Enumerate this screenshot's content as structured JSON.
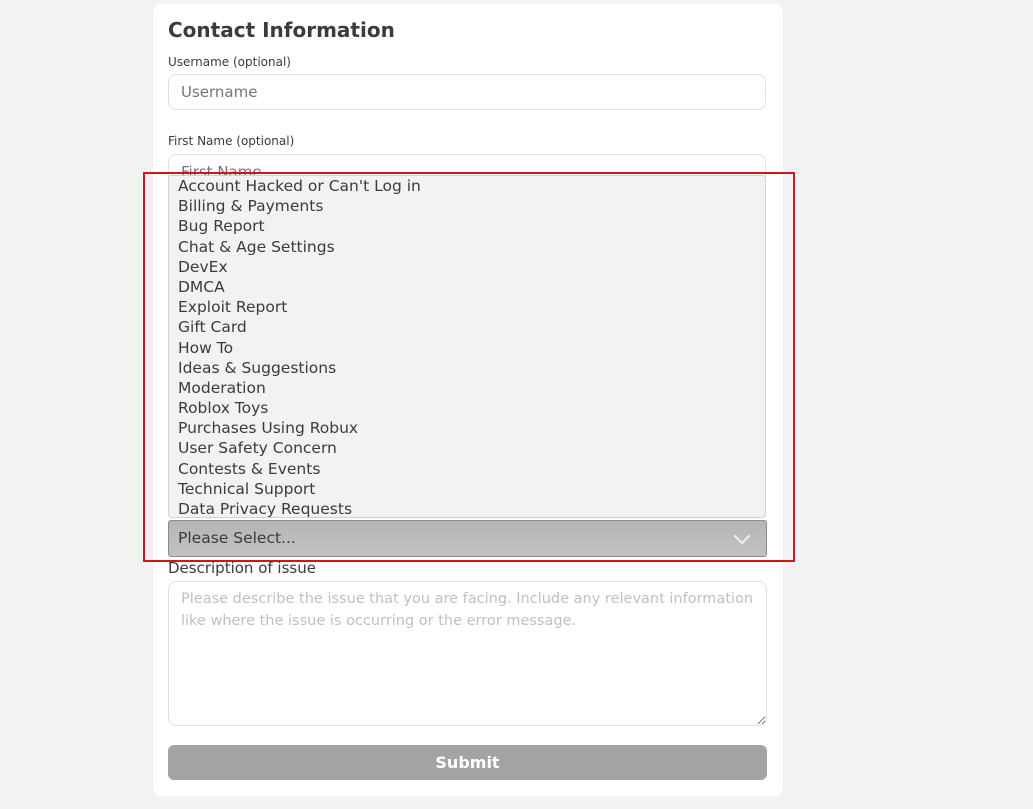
{
  "title": "Contact Information",
  "username": {
    "label": "Username (optional)",
    "placeholder": "Username"
  },
  "first_name": {
    "label": "First Name (optional)",
    "placeholder": "First Name"
  },
  "issue_select": {
    "value": "Please Select...",
    "options": [
      "Account Hacked or Can't Log in",
      "Billing & Payments",
      "Bug Report",
      "Chat & Age Settings",
      "DevEx",
      "DMCA",
      "Exploit Report",
      "Gift Card",
      "How To",
      "Ideas & Suggestions",
      "Moderation",
      "Roblox Toys",
      "Purchases Using Robux",
      "User Safety Concern",
      "Contests & Events",
      "Technical Support",
      "Data Privacy Requests"
    ],
    "icon": "chevron-down-icon"
  },
  "description": {
    "label": "Description of issue",
    "placeholder": "Please describe the issue that you are facing. Include any relevant information like where the issue is occurring or the error message."
  },
  "submit_label": "Submit",
  "colors": {
    "highlight": "#d4121b",
    "submit": "#a3a3a3"
  }
}
